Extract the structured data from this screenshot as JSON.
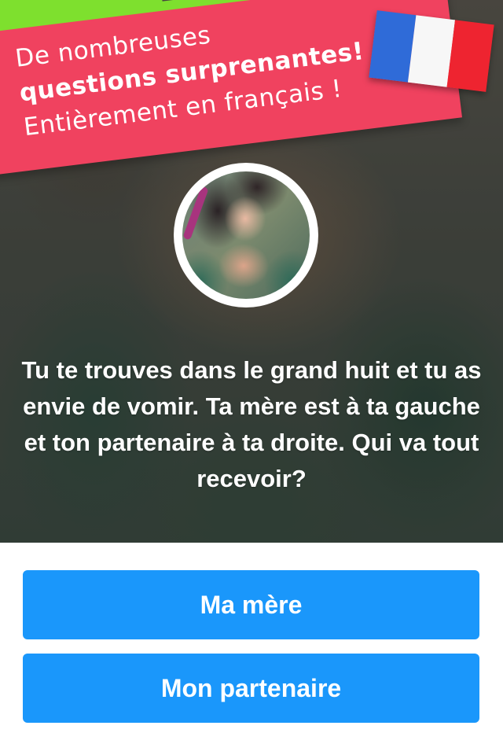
{
  "promo": {
    "line1": "De nombreuses",
    "line2": "questions surprenantes!",
    "line3": "Entièrement en français !"
  },
  "flag": {
    "icon": "french-flag-icon",
    "colors": [
      "#2f6bd8",
      "#f7f7f7",
      "#ee2430"
    ]
  },
  "question": {
    "text": "Tu te trouves dans le grand huit et tu as envie de vomir. Ta mère est à ta gauche et ton partenaire à ta droite. Qui va tout recevoir?"
  },
  "answers": [
    {
      "label": "Ma mère"
    },
    {
      "label": "Mon partenaire"
    }
  ],
  "colors": {
    "banner": "#f0425f",
    "accent_green": "#7ee02e",
    "button": "#1a97fb"
  }
}
